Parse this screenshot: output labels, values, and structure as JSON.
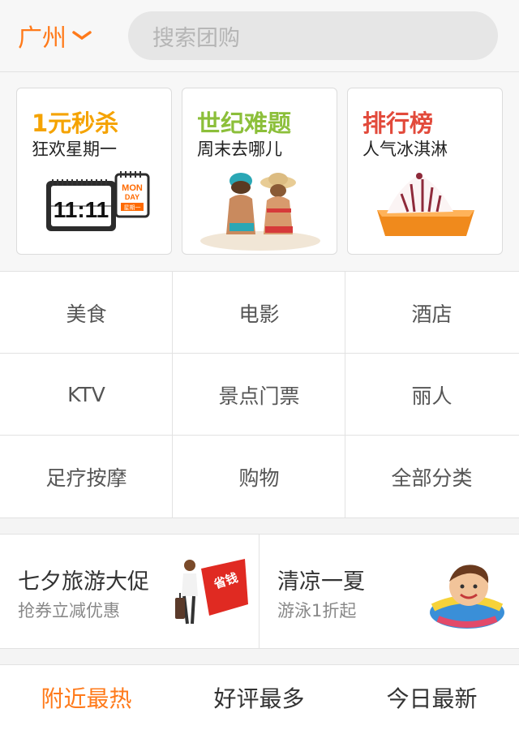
{
  "header": {
    "city": "广州",
    "search_placeholder": "搜索团购"
  },
  "promos": [
    {
      "title": "1元秒杀",
      "subtitle": "狂欢星期一",
      "title_color": "#f5a300",
      "icon": "calendar-icon",
      "calendar_time": "11:11",
      "calendar_day": "MON",
      "calendar_day2": "DAY",
      "calendar_note": "星期一"
    },
    {
      "title": "世纪难题",
      "subtitle": "周末去哪儿",
      "title_color": "#8cbf3a",
      "icon": "beach-couple-image"
    },
    {
      "title": "排行榜",
      "subtitle": "人气冰淇淋",
      "title_color": "#e24a3b",
      "icon": "ice-cream-image"
    }
  ],
  "categories": [
    "美食",
    "电影",
    "酒店",
    "KTV",
    "景点门票",
    "丽人",
    "足疗按摩",
    "购物",
    "全部分类"
  ],
  "banners": [
    {
      "title": "七夕旅游大促",
      "subtitle": "抢券立减优惠",
      "badge": "省钱",
      "icon": "travel-woman-image"
    },
    {
      "title": "清凉一夏",
      "subtitle": "游泳1折起",
      "icon": "swimming-boy-image"
    }
  ],
  "tabs": [
    {
      "label": "附近最热",
      "active": true
    },
    {
      "label": "好评最多",
      "active": false
    },
    {
      "label": "今日最新",
      "active": false
    }
  ],
  "colors": {
    "accent": "#ff7a1a"
  }
}
